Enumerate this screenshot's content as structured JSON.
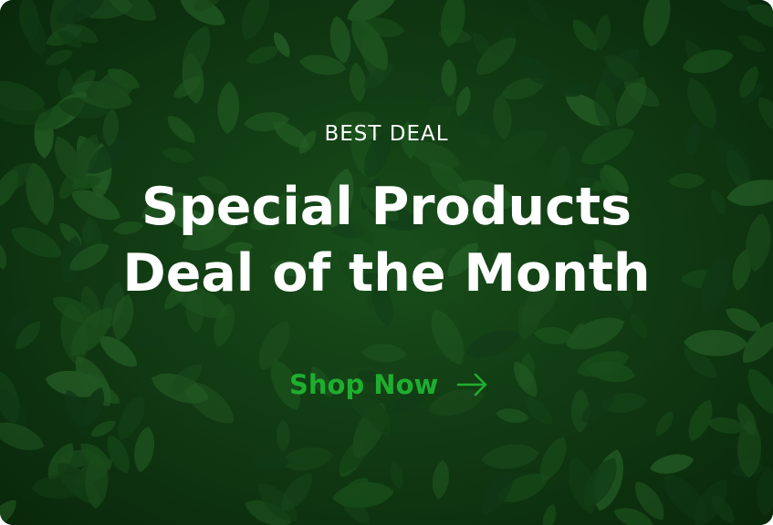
{
  "banner": {
    "eyebrow": "BEST DEAL",
    "headline_line1": "Special Products",
    "headline_line2": "Deal of the Month",
    "cta_label": "Shop Now",
    "cta_icon": "arrow-right-icon",
    "background": "green-leaves",
    "colors": {
      "background": "#0f3d12",
      "text": "#ffffff",
      "accent": "#1fae2f"
    }
  }
}
